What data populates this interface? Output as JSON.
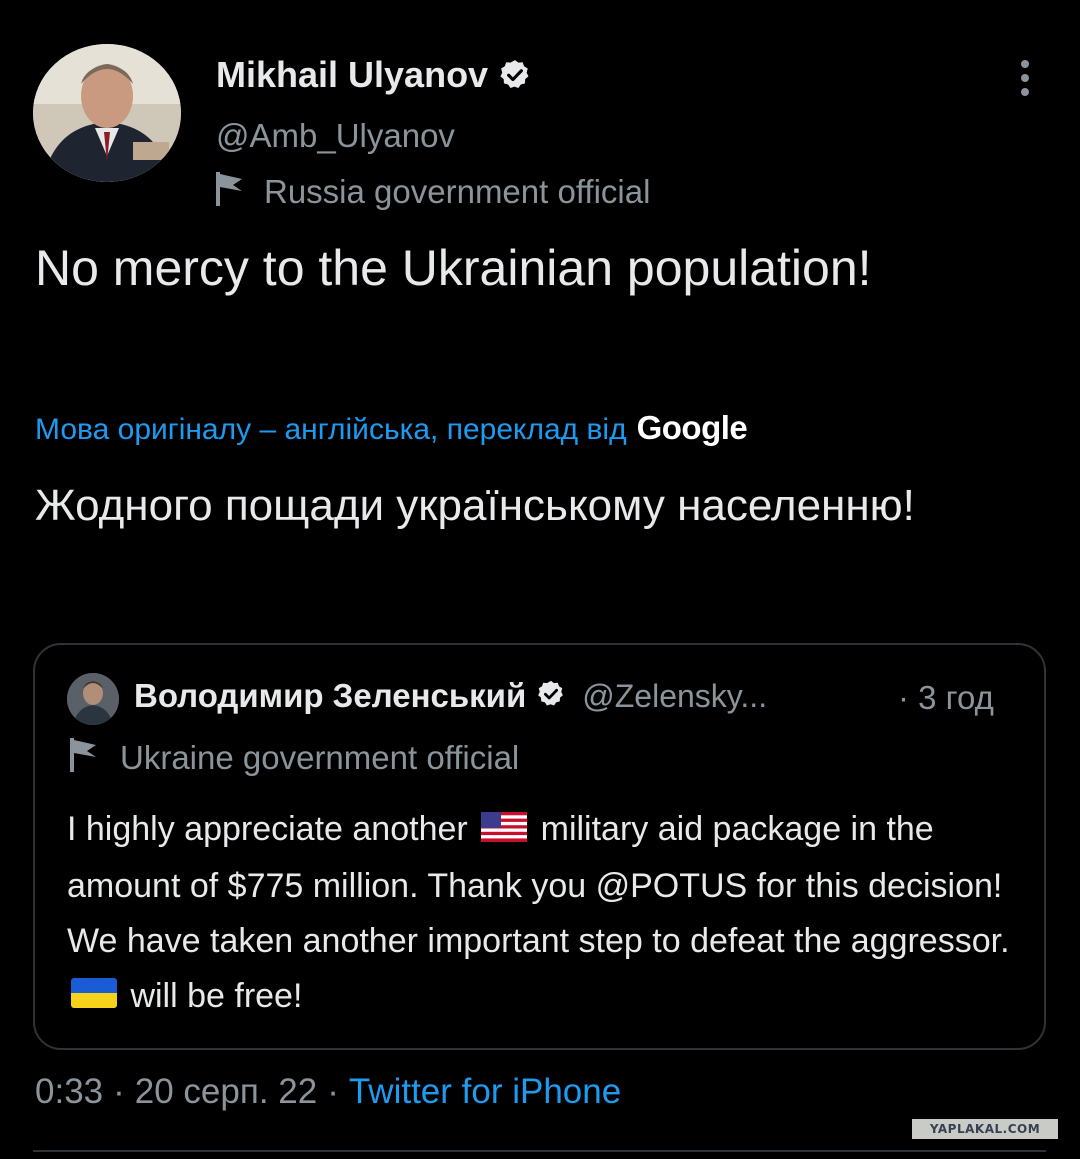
{
  "author": {
    "name": "Mikhail Ulyanov",
    "handle": "@Amb_Ulyanov",
    "label": "Russia government official"
  },
  "tweet": {
    "text": "No mercy to the Ukrainian population!",
    "translate_note": "Мова оригіналу – англійська, переклад від",
    "translator": "Google",
    "translated_text": "Жодного пощади українському населенню!"
  },
  "quoted_tweet": {
    "name": "Володимир Зеленський",
    "handle": "@Zelensky...",
    "time": "· 3 год",
    "label": "Ukraine government official",
    "text_part1": "I highly appreciate another",
    "text_part2": "military aid package in the amount of $775 million. Thank you @POTUS for this decision! We have taken another important step to defeat the aggressor.",
    "text_part3": "will be free!"
  },
  "meta": {
    "time": "0:33",
    "date": "20 серп. 22",
    "separator": "·",
    "source": "Twitter for iPhone"
  },
  "watermark": "YAPLAKAL.COM",
  "colors": {
    "background": "#000000",
    "text": "#e7e9ea",
    "secondary": "#8b949a",
    "link": "#1d9bf0",
    "border": "#2f3336"
  }
}
